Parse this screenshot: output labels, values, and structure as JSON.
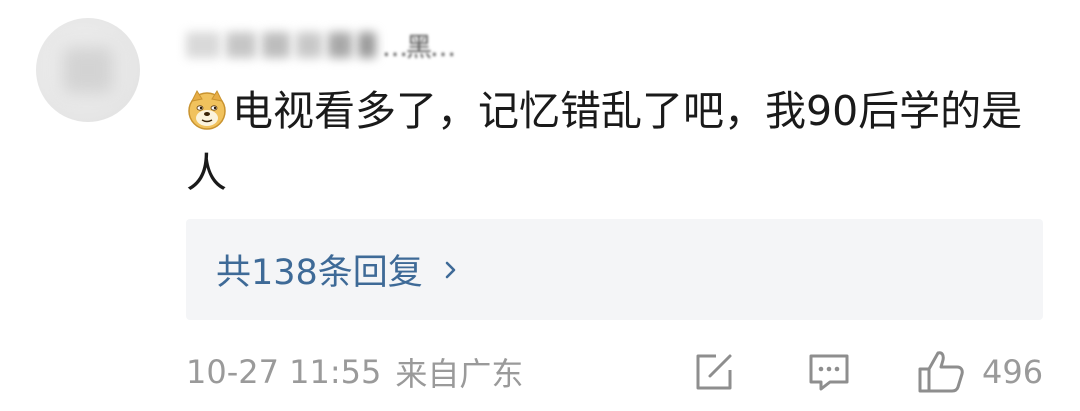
{
  "comment": {
    "username": "…黑…",
    "emoji_icon": "doge-face-icon",
    "text": "电视看多了，记忆错乱了吧，我90后学的是人",
    "replies_label": "共138条回复",
    "time": "10-27 11:55",
    "location": "来自广东",
    "like_count": "496"
  },
  "colors": {
    "reply_link": "#3e6a97",
    "reply_box_bg": "#f4f5f7",
    "meta_text": "#9a9a9a",
    "icon": "#8e8e8e"
  },
  "icons": {
    "share": "share-edit-icon",
    "comment": "comment-bubble-icon",
    "like": "thumbs-up-icon",
    "chevron": "chevron-right-icon"
  }
}
